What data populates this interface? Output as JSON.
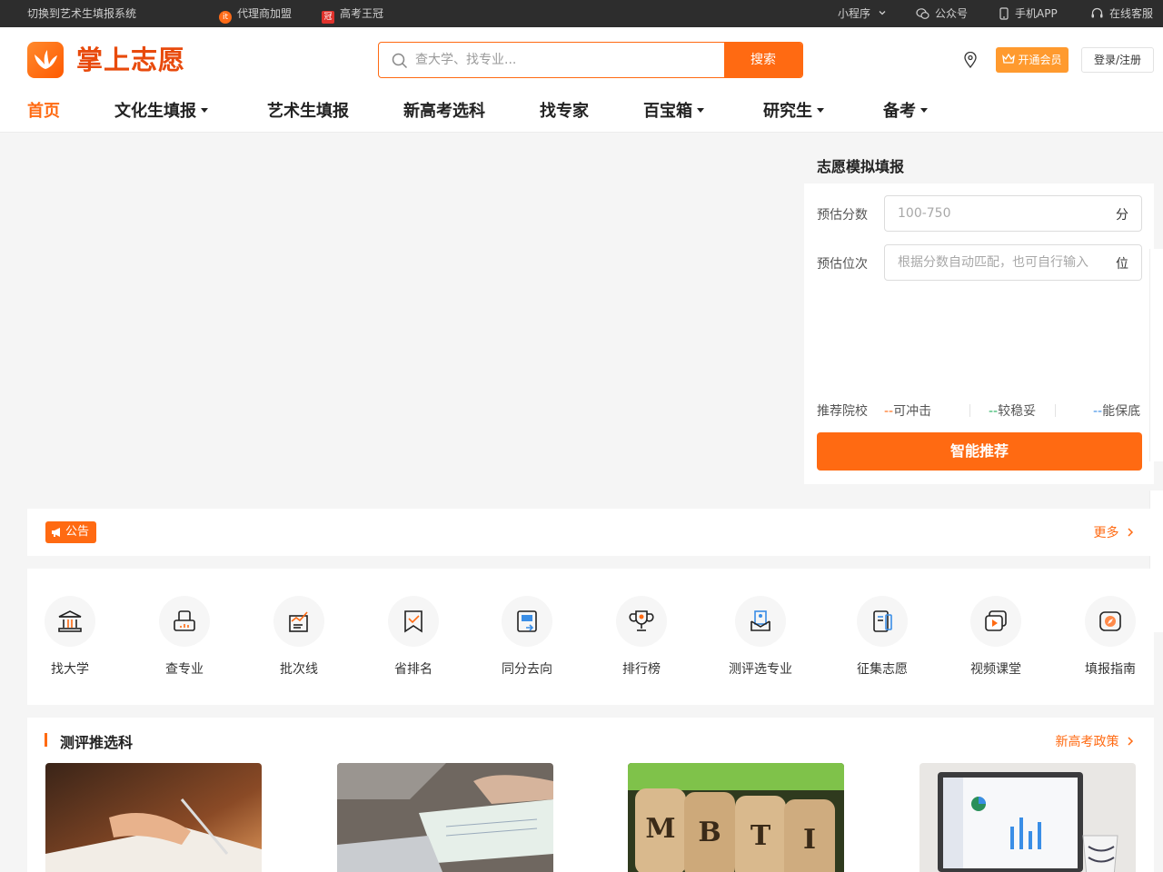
{
  "topbar": {
    "switch_text": "切换到艺术生填报系统",
    "agent_text": "代理商加盟",
    "crown_text": "高考王冠",
    "miniprogram": "小程序",
    "wechat": "公众号",
    "app": "手机APP",
    "service": "在线客服"
  },
  "header": {
    "logo_text": "掌上志愿",
    "search_placeholder": "查大学、找专业...",
    "search_button": "搜索",
    "vip_button": "开通会员",
    "login_button": "登录/注册"
  },
  "nav": {
    "items": [
      {
        "label": "首页"
      },
      {
        "label": "文化生填报"
      },
      {
        "label": "艺术生填报"
      },
      {
        "label": "新高考选科"
      },
      {
        "label": "找专家"
      },
      {
        "label": "百宝箱"
      },
      {
        "label": "研究生"
      },
      {
        "label": "备考"
      }
    ]
  },
  "panel": {
    "title": "志愿模拟填报",
    "score_label": "预估分数",
    "score_placeholder": "100-750",
    "score_unit": "分",
    "rank_label": "预估位次",
    "rank_placeholder": "根据分数自动匹配，也可自行输入",
    "rank_unit": "位",
    "recommend_label": "推荐院校",
    "dash": "--",
    "reach": "可冲击",
    "stable": "较稳妥",
    "safe": "能保底",
    "smart_button": "智能推荐"
  },
  "notice": {
    "badge": "公告",
    "more": "更多"
  },
  "tools": [
    {
      "label": "找大学",
      "icon": "university-icon"
    },
    {
      "label": "查专业",
      "icon": "major-icon"
    },
    {
      "label": "批次线",
      "icon": "batch-line-icon"
    },
    {
      "label": "省排名",
      "icon": "province-rank-icon"
    },
    {
      "label": "同分去向",
      "icon": "same-score-icon"
    },
    {
      "label": "排行榜",
      "icon": "trophy-icon"
    },
    {
      "label": "测评选专业",
      "icon": "assessment-icon"
    },
    {
      "label": "征集志愿",
      "icon": "collect-icon"
    },
    {
      "label": "视频课堂",
      "icon": "video-icon"
    },
    {
      "label": "填报指南",
      "icon": "guide-icon"
    }
  ],
  "section": {
    "title": "测评推选科",
    "link": "新高考政策",
    "cards": [
      {
        "image": "writing-photo"
      },
      {
        "image": "laptop-notes-photo"
      },
      {
        "image": "mbti-blocks-photo",
        "letters": [
          "M",
          "B",
          "T",
          "I"
        ]
      },
      {
        "image": "laptop-dashboard-photo"
      }
    ]
  }
}
